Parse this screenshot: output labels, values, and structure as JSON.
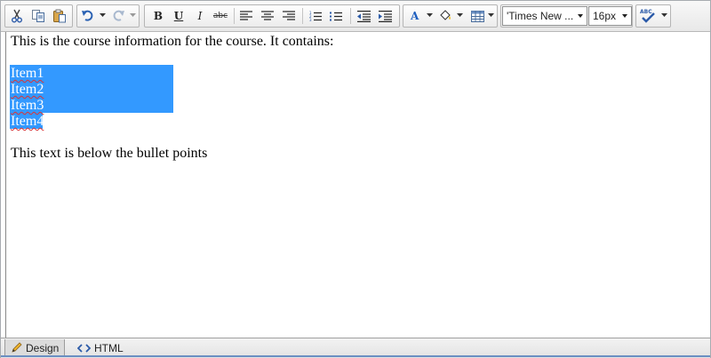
{
  "toolbar": {
    "font_name": "'Times New ...",
    "font_size": "16px"
  },
  "content": {
    "intro": "This is the course information for the course. It contains:",
    "items": [
      "Item1",
      "Item2",
      "Item3",
      "Item4"
    ],
    "below": "This text is below the bullet points"
  },
  "tabs": {
    "design": "Design",
    "html": "HTML"
  },
  "icons": {
    "cut": "cut-icon",
    "copy": "copy-icon",
    "paste": "paste-icon",
    "undo": "undo-icon",
    "redo": "redo-icon",
    "bold": "B",
    "underline": "U",
    "italic": "I",
    "strikethrough": "abc",
    "spellcheck": "ABC"
  },
  "colors": {
    "selection": "#3399ff",
    "font_color": "#1f5fbf",
    "misspelling": "#dd3333"
  }
}
